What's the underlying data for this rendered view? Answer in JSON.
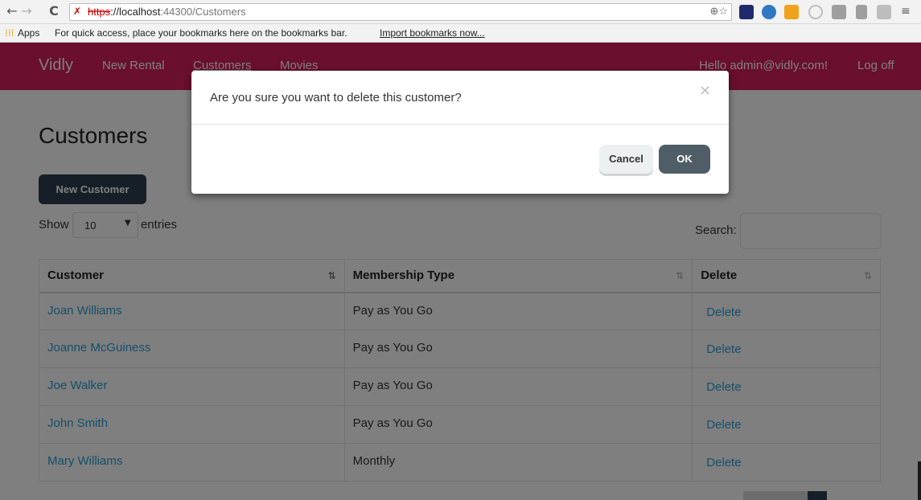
{
  "browser": {
    "url_scheme": "https",
    "url_host": "://localhost",
    "url_port_path": ":44300/Customers",
    "nav": {
      "back": "←",
      "forward": "→",
      "reload": "C"
    },
    "omnibox_icons": "⊕☆",
    "bookmarks": {
      "apps_label": "Apps",
      "hint": "For quick access, place your bookmarks here on the bookmarks bar.",
      "import_link": "Import bookmarks now..."
    },
    "extensions": [
      "bookmark-manager-icon",
      "globe-icon",
      "rss-icon",
      "power-icon",
      "save-icon",
      "tray-icon",
      "feed-icon",
      "menu-icon"
    ],
    "extension_colors": [
      "#1e2a6b",
      "#2f78c2",
      "#f0a21a",
      "#bdbdbd",
      "#9e9e9e",
      "#9e9e9e",
      "#bdbdbd",
      "#555555"
    ]
  },
  "navbar": {
    "brand": "Vidly",
    "links": [
      "New Rental",
      "Customers",
      "Movies"
    ],
    "greeting": "Hello admin@vidly.com!",
    "logoff": "Log off",
    "color": "#d41f5a"
  },
  "page": {
    "title": "Customers",
    "new_button": "New Customer",
    "show_label": "Show",
    "entries_label": "entries",
    "page_length": "10",
    "search_label": "Search:",
    "search_value": ""
  },
  "table": {
    "columns": [
      "Customer",
      "Membership Type",
      "Delete"
    ],
    "rows": [
      {
        "name": "Joan Williams",
        "membership": "Pay as You Go",
        "action": "Delete"
      },
      {
        "name": "Joanne McGuiness",
        "membership": "Pay as You Go",
        "action": "Delete"
      },
      {
        "name": "Joe Walker",
        "membership": "Pay as You Go",
        "action": "Delete"
      },
      {
        "name": "John Smith",
        "membership": "Pay as You Go",
        "action": "Delete"
      },
      {
        "name": "Mary Williams",
        "membership": "Monthly",
        "action": "Delete"
      }
    ]
  },
  "modal": {
    "message": "Are you sure you want to delete this customer?",
    "close": "×",
    "cancel": "Cancel",
    "ok": "OK"
  }
}
